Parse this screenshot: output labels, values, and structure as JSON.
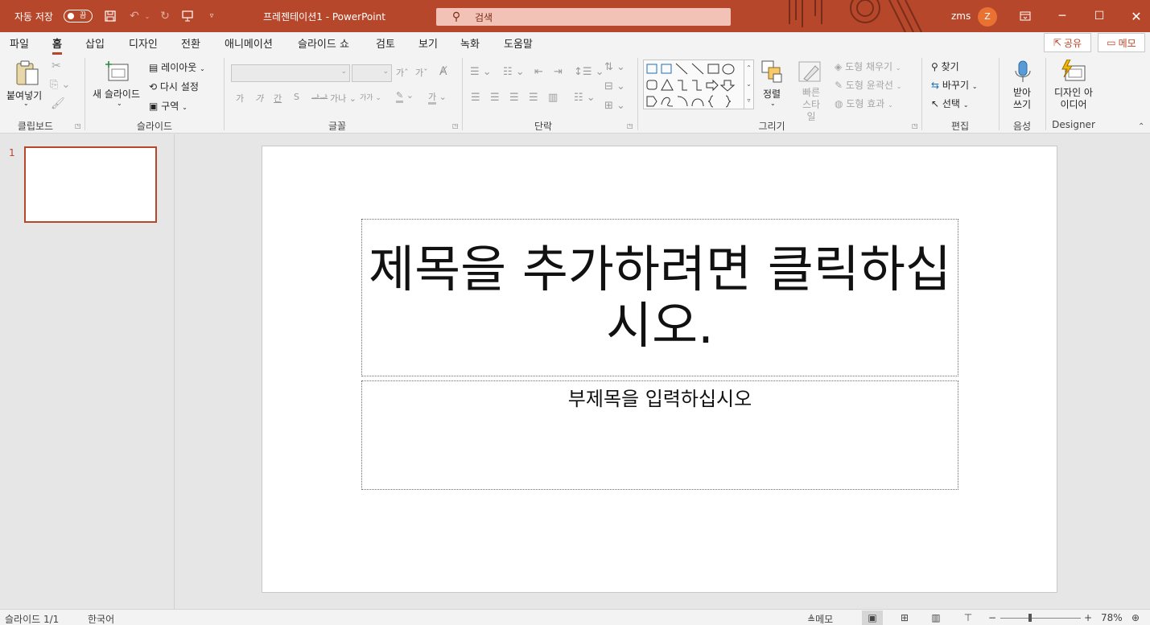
{
  "titlebar": {
    "autosave_label": "자동 저장",
    "autosave_state": "끔",
    "doc_title": "프레젠테이션1  -  PowerPoint",
    "search_placeholder": "검색",
    "user_name": "zms",
    "avatar_initial": "Z",
    "accent_color": "#b7472a"
  },
  "menu": {
    "tabs": [
      "파일",
      "홈",
      "삽입",
      "디자인",
      "전환",
      "애니메이션",
      "슬라이드 쇼",
      "검토",
      "보기",
      "녹화",
      "도움말"
    ],
    "active_tab": "홈",
    "share_label": "공유",
    "memo_label": "메모"
  },
  "ribbon": {
    "clipboard": {
      "paste_label": "붙여넣기",
      "group_label": "클립보드"
    },
    "slides": {
      "new_slide_label": "새 슬라이드",
      "layout_label": "레이아웃",
      "reset_label": "다시 설정",
      "section_label": "구역",
      "group_label": "슬라이드"
    },
    "font": {
      "group_label": "글꼴",
      "format_buttons": [
        "가",
        "가",
        "간",
        "S",
        "ᆎ",
        "가나",
        "가가"
      ]
    },
    "paragraph": {
      "group_label": "단락"
    },
    "drawing": {
      "arrange_label": "정렬",
      "quick_styles_label": "빠른 스타일",
      "fill_label": "도형 채우기",
      "outline_label": "도형 윤곽선",
      "effects_label": "도형 효과",
      "group_label": "그리기"
    },
    "editing": {
      "find_label": "찾기",
      "replace_label": "바꾸기",
      "select_label": "선택",
      "group_label": "편집"
    },
    "voice": {
      "dictate_label": "받아 쓰기",
      "group_label": "음성"
    },
    "designer": {
      "ideas_label": "디자인 아이디어",
      "group_label": "Designer"
    }
  },
  "thumbnails": {
    "slide_number": "1"
  },
  "slide": {
    "title_placeholder": "제목을 추가하려면 클릭하십시오.",
    "subtitle_placeholder": "부제목을 입력하십시오"
  },
  "status": {
    "slide_counter": "슬라이드 1/1",
    "language": "한국어",
    "notes_label": "메모",
    "zoom": "78%",
    "zoom_minus": "−",
    "zoom_plus": "+"
  }
}
